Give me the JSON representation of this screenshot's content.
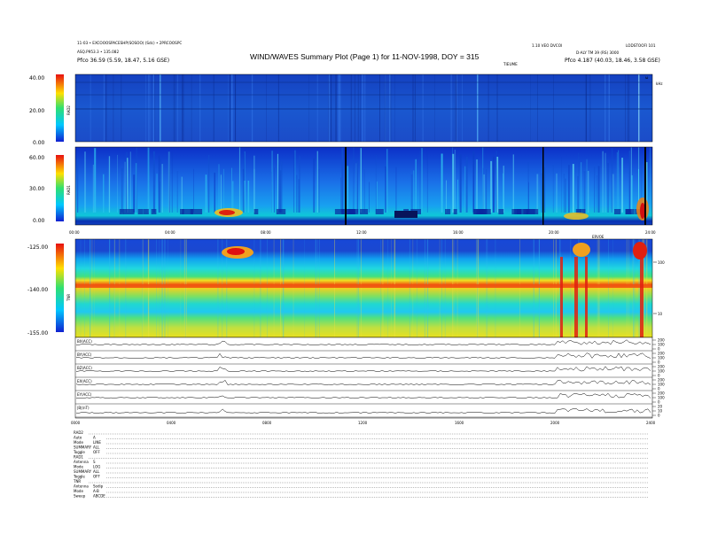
{
  "header": {
    "title": "WIND/WAVES Summary Plot (Page 1) for 11-NOV-1998, DOY = 315",
    "left_line1": "11-03 • EXCOOOSPACESHP(SOSOO) (Sdc) • 2PRCOOSPC",
    "left_line2": "ASQ.P953.3 • 135.082",
    "left_line3": "Pfco   36.59 (5.59, 18.47, 5.16 GSE)",
    "mid_right": "TIEUME",
    "right_line1": "1.10 VEO DVCOI",
    "right_line1b": "LODSTOOFI 101",
    "right_line2": "D-ALY TM 39 (RS) 3000",
    "right_line3": "Pfco   4.187 (40.03, 18.46, 3.58 GSE)"
  },
  "time_ticks": [
    "00:00",
    "04:00",
    "08:00",
    "12:00",
    "16:00",
    "20:00",
    "24:00"
  ],
  "time_ticks_bottom": [
    "0000",
    "0400",
    "0800",
    "1200",
    "1600",
    "2000",
    "2400"
  ],
  "right_marker_label": "ERVOE",
  "khz_unit": "kHz",
  "chart_data": [
    {
      "type": "heatmap",
      "panel": "RAD2",
      "ylabel": "RAD2",
      "yticks": [
        "40.00",
        "20.00",
        "0.00"
      ],
      "ylim": [
        0,
        40
      ],
      "xlim_hours": [
        0,
        24
      ],
      "colorbar": "blue-cyan-green-yellow-red"
    },
    {
      "type": "heatmap",
      "panel": "RAD1",
      "ylabel": "RAD1",
      "yticks": [
        "60.00",
        "30.00",
        "0.00"
      ],
      "ylim": [
        0,
        60
      ],
      "xlim_hours": [
        0,
        24
      ],
      "colorbar": "blue-cyan-green-yellow-red"
    },
    {
      "type": "heatmap",
      "panel": "TNR",
      "ylabel": "TNR",
      "yticks": [
        "-125.00",
        "-140.00",
        "-155.00"
      ],
      "ylim": [
        -155,
        -125
      ],
      "right_ticks": [
        "100",
        "10"
      ],
      "xlim_hours": [
        0,
        24
      ],
      "colorbar": "blue-cyan-green-yellow-red"
    },
    {
      "type": "line",
      "panel": "stack",
      "series": [
        {
          "name": "BX(ACC)",
          "right_ticks": [
            "200",
            "100",
            "0"
          ]
        },
        {
          "name": "BY(ACC)",
          "right_ticks": [
            "200",
            "100",
            "0"
          ]
        },
        {
          "name": "BZ(ACC)",
          "right_ticks": [
            "200",
            "100",
            "0"
          ]
        },
        {
          "name": "EX(ACC)",
          "right_ticks": [
            "200",
            "100",
            "0"
          ]
        },
        {
          "name": "EY(ACC)",
          "right_ticks": [
            "200",
            "100",
            "0"
          ]
        },
        {
          "name": "|B|(nT)",
          "right_ticks": [
            "20",
            "10",
            "0"
          ]
        }
      ]
    }
  ],
  "legend_blocks": [
    {
      "name": "RAD2",
      "rows": [
        [
          "Auto",
          "A"
        ],
        [
          "Mode",
          "LINE"
        ],
        [
          "SUMMARY",
          "ALL"
        ],
        [
          "Toggle",
          "OFF"
        ]
      ]
    },
    {
      "name": "RAD1",
      "rows": [
        [
          "Antenna",
          "S"
        ],
        [
          "Mode",
          "LOG"
        ],
        [
          "SUMMARY",
          "ALL"
        ],
        [
          "Toggle",
          "OFF"
        ]
      ]
    },
    {
      "name": "TNR",
      "rows": [
        [
          "Antenna",
          "Sodip"
        ],
        [
          "Mode",
          "A-B"
        ],
        [
          "Sweep",
          "ABCDE"
        ]
      ]
    }
  ]
}
